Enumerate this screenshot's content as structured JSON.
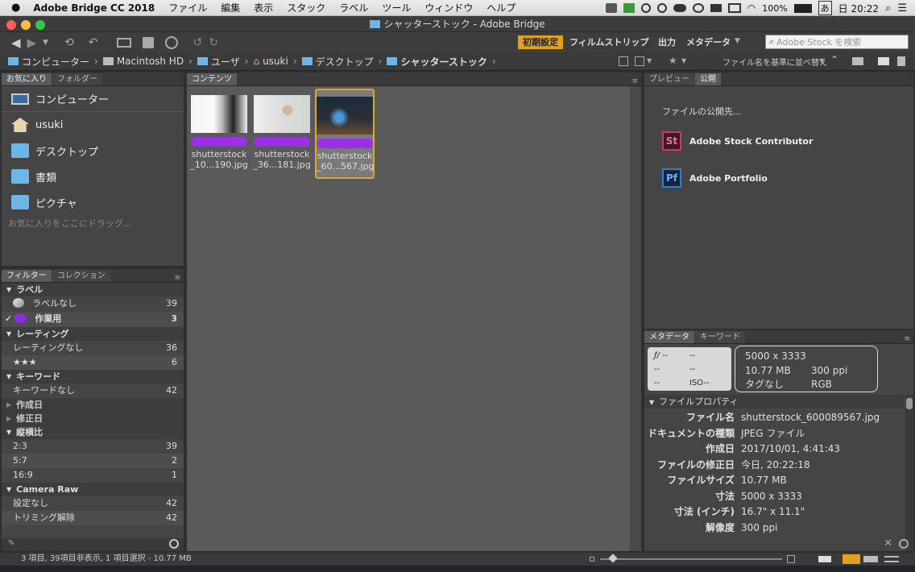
{
  "menubar": {
    "app": "Adobe Bridge CC 2018",
    "items": [
      "ファイル",
      "編集",
      "表示",
      "スタック",
      "ラベル",
      "ツール",
      "ウィンドウ",
      "ヘルプ"
    ],
    "battery": "100%",
    "input": "あ",
    "clock": "日 20:22"
  },
  "window": {
    "title": "シャッターストック - Adobe Bridge"
  },
  "toolbar": {
    "workspace_active": "初期設定",
    "workspaces": [
      "フィルムストリップ",
      "出力",
      "メタデータ"
    ],
    "search_placeholder": "Adobe Stock を検索"
  },
  "path": {
    "crumbs": [
      "コンピューター",
      "Macintosh HD",
      "ユーザ",
      "usuki",
      "デスクトップ",
      "シャッターストック"
    ],
    "sort": "ファイル名を基準に並べ替え"
  },
  "left": {
    "tabs": [
      "お気に入り",
      "フォルダー"
    ],
    "favorites": [
      "コンピューター",
      "usuki",
      "デスクトップ",
      "書類",
      "ピクチャ"
    ],
    "drop_hint": "お気に入りをここにドラッグ..."
  },
  "filter": {
    "tabs": [
      "フィルター",
      "コレクション"
    ],
    "groups": [
      {
        "name": "ラベル",
        "open": true,
        "rows": [
          {
            "label": "ラベルなし",
            "count": "39"
          },
          {
            "label": "作業用",
            "count": "3",
            "checked": true
          }
        ]
      },
      {
        "name": "レーティング",
        "open": true,
        "rows": [
          {
            "label": "レーティングなし",
            "count": "36"
          },
          {
            "label": "★★★",
            "count": "6"
          }
        ]
      },
      {
        "name": "キーワード",
        "open": true,
        "rows": [
          {
            "label": "キーワードなし",
            "count": "42"
          }
        ]
      },
      {
        "name": "作成日",
        "open": false,
        "rows": []
      },
      {
        "name": "修正日",
        "open": false,
        "rows": []
      },
      {
        "name": "縦横比",
        "open": true,
        "rows": [
          {
            "label": "2:3",
            "count": "39"
          },
          {
            "label": "5:7",
            "count": "2"
          },
          {
            "label": "16:9",
            "count": "1"
          }
        ]
      },
      {
        "name": "Camera Raw",
        "open": true,
        "rows": [
          {
            "label": "設定なし",
            "count": "42"
          },
          {
            "label": "トリミング解除",
            "count": "42"
          }
        ]
      }
    ]
  },
  "content": {
    "tab": "コンテンツ",
    "items": [
      {
        "line1": "shutterstock",
        "line2": "_10...190.jpg"
      },
      {
        "line1": "shutterstock",
        "line2": "_36...181.jpg"
      },
      {
        "line1": "shutterstock",
        "line2": "_60...567.jpg",
        "selected": true
      }
    ]
  },
  "right": {
    "tabs": [
      "プレビュー",
      "公開"
    ],
    "publish_heading": "ファイルの公開先...",
    "targets": [
      {
        "icon": "St",
        "name": "Adobe Stock Contributor",
        "color": "#d6336c"
      },
      {
        "icon": "Pf",
        "name": "Adobe Portfolio",
        "color": "#2f7fd6"
      }
    ]
  },
  "metadata": {
    "tabs": [
      "メタデータ",
      "キーワード"
    ],
    "camera": [
      "ƒ/ --",
      "--",
      "--",
      "--",
      "--",
      "ISO--"
    ],
    "summary": {
      "dims": "5000 x 3333",
      "size": "10.77 MB",
      "ppi": "300 ppi",
      "tags": "タグなし",
      "mode": "RGB"
    },
    "section": "ファイルプロパティ",
    "rows": [
      {
        "k": "ファイル名",
        "v": "shutterstock_600089567.jpg"
      },
      {
        "k": "ドキュメントの種類",
        "v": "JPEG ファイル"
      },
      {
        "k": "作成日",
        "v": "2017/10/01, 4:41:43"
      },
      {
        "k": "ファイルの修正日",
        "v": "今日, 20:22:18"
      },
      {
        "k": "ファイルサイズ",
        "v": "10.77 MB"
      },
      {
        "k": "寸法",
        "v": "5000 x 3333"
      },
      {
        "k": "寸法 (インチ)",
        "v": "16.7\" x 11.1\""
      },
      {
        "k": "解像度",
        "v": "300 ppi"
      }
    ]
  },
  "status": {
    "text": "3 項目, 39項目非表示, 1 項目選択 - 10.77 MB"
  }
}
